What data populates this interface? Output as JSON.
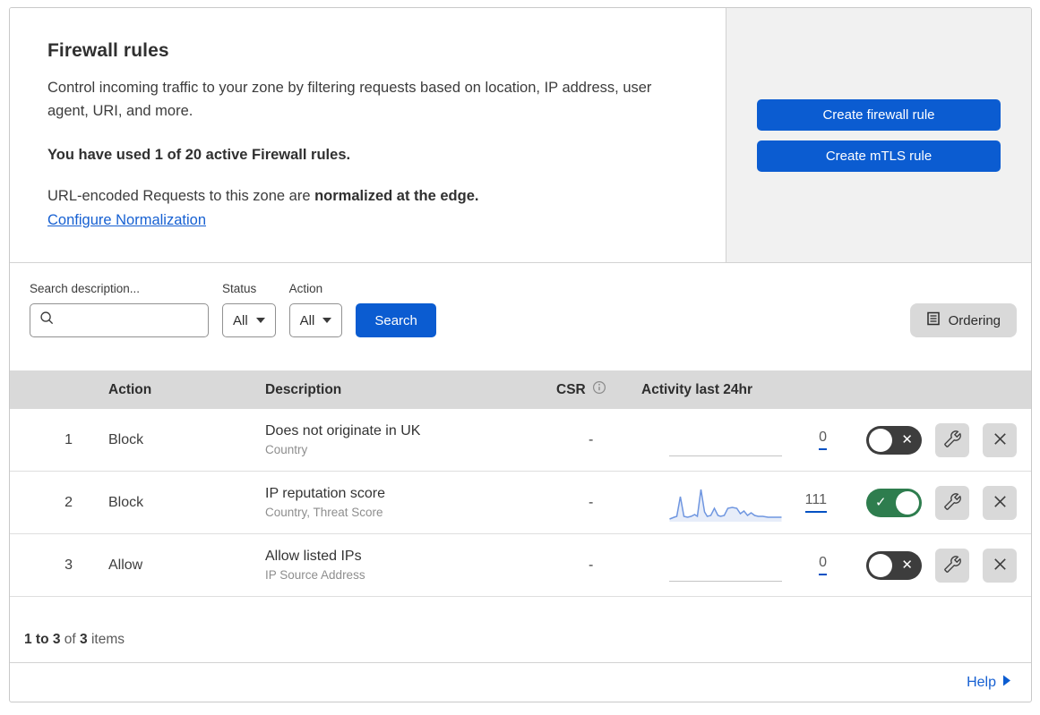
{
  "header": {
    "title": "Firewall rules",
    "description": "Control incoming traffic to your zone by filtering requests based on location, IP address, user agent, URI, and more.",
    "usage_statement": "You have used 1 of 20 active Firewall rules.",
    "normalization_prefix": "URL-encoded Requests to this zone are ",
    "normalization_bold": "normalized at the edge.",
    "normalization_link": "Configure Normalization",
    "create_firewall_button": "Create firewall rule",
    "create_mtls_button": "Create mTLS rule"
  },
  "filters": {
    "search_label": "Search description...",
    "status_label": "Status",
    "status_value": "All",
    "action_label": "Action",
    "action_value": "All",
    "search_button": "Search",
    "ordering_button": "Ordering"
  },
  "table": {
    "columns": {
      "action": "Action",
      "description": "Description",
      "csr": "CSR",
      "activity": "Activity last 24hr"
    },
    "rows": [
      {
        "index": "1",
        "action": "Block",
        "description": "Does not originate in UK",
        "criteria": "Country",
        "csr": "-",
        "activity_count": "0",
        "enabled": false,
        "sparkline": null
      },
      {
        "index": "2",
        "action": "Block",
        "description": "IP reputation score",
        "criteria": "Country, Threat Score",
        "csr": "-",
        "activity_count": "111",
        "enabled": true,
        "sparkline": [
          [
            0,
            37
          ],
          [
            5,
            35
          ],
          [
            8,
            34
          ],
          [
            12,
            12
          ],
          [
            16,
            34
          ],
          [
            20,
            35
          ],
          [
            24,
            34
          ],
          [
            28,
            32
          ],
          [
            31,
            34
          ],
          [
            35,
            4
          ],
          [
            39,
            29
          ],
          [
            42,
            34
          ],
          [
            46,
            33
          ],
          [
            50,
            25
          ],
          [
            54,
            33
          ],
          [
            57,
            34
          ],
          [
            61,
            33
          ],
          [
            65,
            25
          ],
          [
            70,
            24
          ],
          [
            75,
            25
          ],
          [
            79,
            31
          ],
          [
            83,
            28
          ],
          [
            87,
            33
          ],
          [
            91,
            30
          ],
          [
            95,
            33
          ],
          [
            99,
            34
          ],
          [
            104,
            34
          ],
          [
            110,
            35
          ],
          [
            117,
            35
          ],
          [
            125,
            35
          ]
        ]
      },
      {
        "index": "3",
        "action": "Allow",
        "description": "Allow listed IPs",
        "criteria": "IP Source Address",
        "csr": "-",
        "activity_count": "0",
        "enabled": false,
        "sparkline": null
      }
    ]
  },
  "footer": {
    "range": "1 to 3",
    "of_text": "of",
    "total": "3",
    "items_text": "items",
    "help_label": "Help"
  },
  "toggle": {
    "on_mark": "✓",
    "off_mark": "✕"
  },
  "colors": {
    "accent_blue": "#0b5cd1",
    "link_blue": "#1660d2",
    "count_underline_blue": "#0051c3",
    "toggle_on_green": "#2e7d4e",
    "toggle_off_gray": "#3d3d3d",
    "sparkline_blue": "#6f96e0",
    "sparkline_fill": "#e7edf9",
    "table_header_gray": "#d9d9d9",
    "panel_gray": "#f1f1f1"
  }
}
